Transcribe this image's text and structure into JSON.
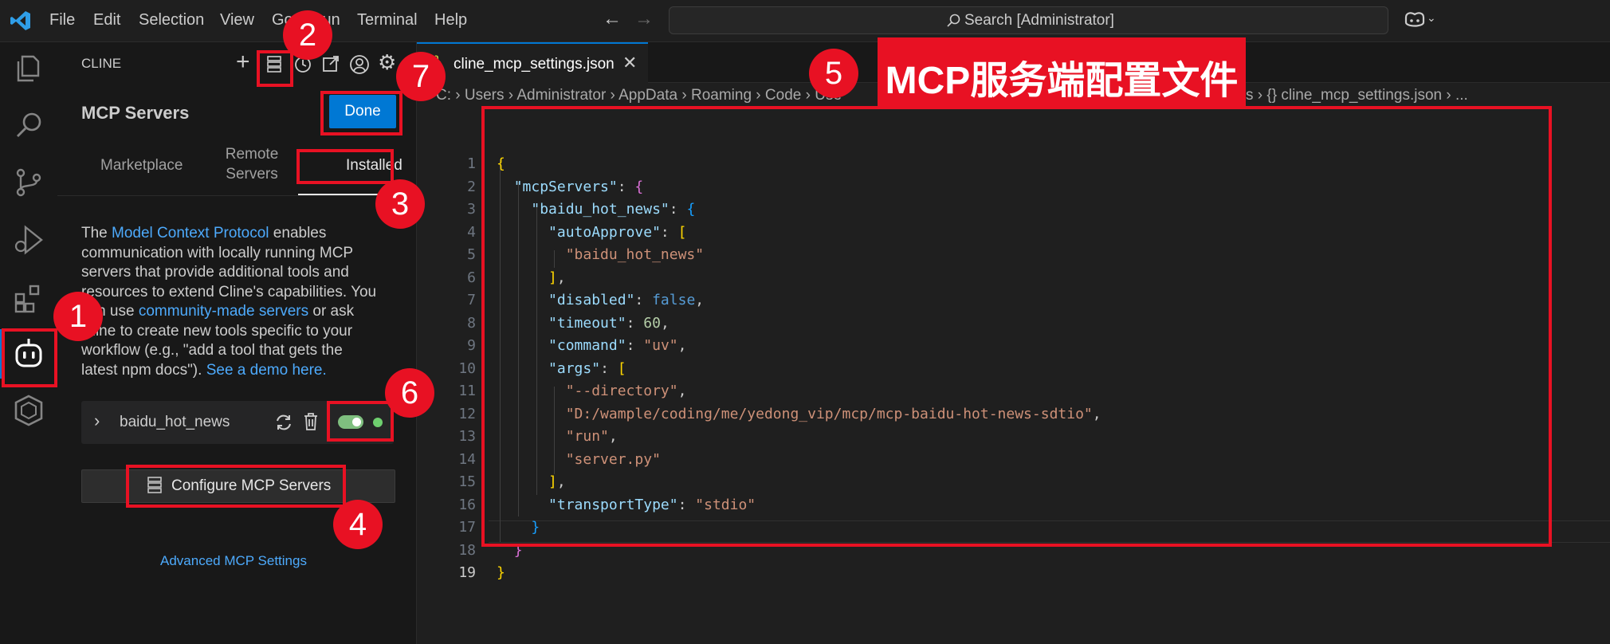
{
  "menu": [
    "File",
    "Edit",
    "Selection",
    "View",
    "Go",
    "Run",
    "Terminal",
    "Help"
  ],
  "search": {
    "text": "Search [Administrator]"
  },
  "cline": {
    "header": "CLINE",
    "title": "MCP Servers",
    "done": "Done",
    "tabs": {
      "marketplace": "Marketplace",
      "remote1": "Remote",
      "remote2": "Servers",
      "installed": "Installed"
    },
    "desc": {
      "l1a": "The ",
      "link1": "Model Context Protocol",
      "l1b": " enables",
      "l2": "communication with locally running MCP",
      "l3": "servers that provide additional tools and",
      "l4": "resources to extend Cline's capabilities. You",
      "l5a": "can use ",
      "link2": "community-made servers",
      "l5b": " or ask",
      "l6": "Cline to create new tools specific to your",
      "l7": "workflow (e.g., \"add a tool that gets the",
      "l8a": "latest npm docs\"). ",
      "link3": "See a demo here."
    },
    "server_name": "baidu_hot_news",
    "configure": "Configure MCP Servers",
    "advanced": "Advanced MCP Settings"
  },
  "editor": {
    "tab": "cline_mcp_settings.json",
    "breadcrumbs": [
      "C:",
      "Users",
      "Administrator",
      "AppData",
      "Roaming",
      "Code",
      "Use",
      "s",
      "{} cline_mcp_settings.json",
      "..."
    ],
    "code": {
      "mcpServers": "\"mcpServers\"",
      "server": "\"baidu_hot_news\"",
      "autoApprove": "\"autoApprove\"",
      "approveItem": "\"baidu_hot_news\"",
      "disabled": "\"disabled\"",
      "disabledVal": "false",
      "timeout": "\"timeout\"",
      "timeoutVal": "60",
      "command": "\"command\"",
      "commandVal": "\"uv\"",
      "args": "\"args\"",
      "arg1": "\"--directory\"",
      "arg2": "\"D:/wample/coding/me/yedong_vip/mcp/mcp-baidu-hot-news-sdtio\"",
      "arg3": "\"run\"",
      "arg4": "\"server.py\"",
      "transportType": "\"transportType\"",
      "transportVal": "\"stdio\""
    }
  },
  "annotation": {
    "banner": "MCP服务端配置文件",
    "badges": [
      "1",
      "2",
      "3",
      "4",
      "5",
      "6",
      "7"
    ]
  },
  "colors": {
    "accent": "#0078d4",
    "annotation": "#e81123",
    "toggle": "#7fbf7f"
  }
}
